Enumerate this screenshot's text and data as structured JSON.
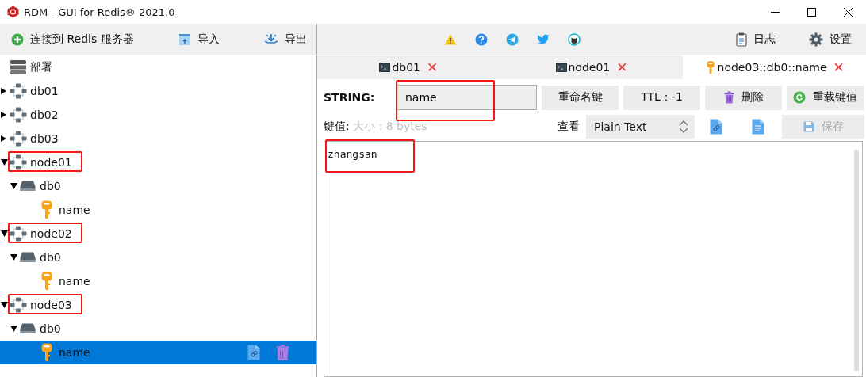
{
  "window": {
    "title": "RDM - GUI for Redis® 2021.0"
  },
  "toolbar": {
    "left": [
      {
        "kind": "add",
        "label": "连接到 Redis 服务器"
      },
      {
        "kind": "import",
        "label": "导入"
      },
      {
        "kind": "export",
        "label": "导出"
      }
    ],
    "links": [
      {
        "kind": "warning"
      },
      {
        "kind": "help"
      },
      {
        "kind": "plane"
      },
      {
        "kind": "bird"
      },
      {
        "kind": "cat"
      }
    ],
    "right": [
      {
        "kind": "log",
        "label": "日志"
      },
      {
        "kind": "settings",
        "label": "设置"
      }
    ]
  },
  "tree": [
    {
      "kind": "group",
      "label": "部署",
      "selected": false,
      "highlighted": false
    },
    {
      "kind": "server",
      "label": "db01",
      "expanded": false,
      "selected": false,
      "highlighted": false
    },
    {
      "kind": "server",
      "label": "db02",
      "expanded": false,
      "selected": false,
      "highlighted": false
    },
    {
      "kind": "server",
      "label": "db03",
      "expanded": false,
      "selected": false,
      "highlighted": false
    },
    {
      "kind": "server",
      "label": "node01",
      "expanded": true,
      "selected": false,
      "highlighted": true,
      "children": [
        {
          "kind": "database",
          "label": "db0",
          "expanded": true,
          "selected": false,
          "highlighted": false,
          "children": [
            {
              "kind": "key",
              "label": "name",
              "selected": false,
              "highlighted": false
            }
          ]
        }
      ]
    },
    {
      "kind": "server",
      "label": "node02",
      "expanded": true,
      "selected": false,
      "highlighted": true,
      "children": [
        {
          "kind": "database",
          "label": "db0",
          "expanded": true,
          "selected": false,
          "highlighted": false,
          "children": [
            {
              "kind": "key",
              "label": "name",
              "selected": false,
              "highlighted": false
            }
          ]
        }
      ]
    },
    {
      "kind": "server",
      "label": "node03",
      "expanded": true,
      "selected": false,
      "highlighted": true,
      "children": [
        {
          "kind": "database",
          "label": "db0",
          "expanded": true,
          "selected": false,
          "highlighted": false,
          "children": [
            {
              "kind": "key",
              "label": "name",
              "selected": true,
              "highlighted": false
            }
          ]
        }
      ]
    }
  ],
  "tabs": [
    {
      "kind": "console",
      "label": "db01",
      "close": "✕",
      "selected": false
    },
    {
      "kind": "console",
      "label": "node01",
      "close": "✕",
      "selected": false
    },
    {
      "kind": "key",
      "label": "node03::db0::name",
      "close": "✕",
      "selected": true
    }
  ],
  "editor": {
    "type": "STRING:",
    "key": "name",
    "key_highlighted": true,
    "buttons": [
      {
        "kind": "plain",
        "label": "重命名键"
      },
      {
        "kind": "plain",
        "label": "TTL：-1"
      },
      {
        "kind": "trash",
        "label": "删除"
      },
      {
        "kind": "reload",
        "label": "重载键值"
      }
    ],
    "value_label": "键值:",
    "size": "大小：8 bytes",
    "view_label": "查看",
    "view_mode": "Plain Text",
    "save": {
      "label": "保存",
      "disabled": true
    },
    "value": "zhangsan",
    "value_highlighted": true
  }
}
